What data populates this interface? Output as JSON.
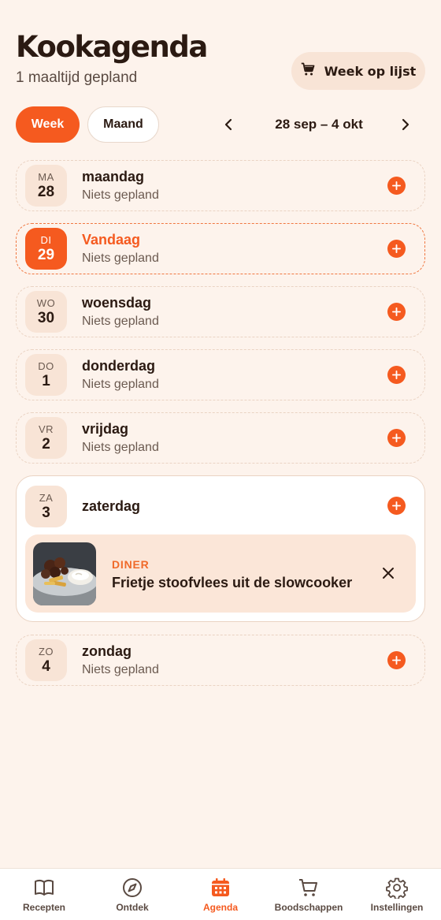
{
  "header": {
    "title": "Kookagenda",
    "subtitle": "1 maaltijd gepland",
    "week_list_label": "Week op lijst"
  },
  "controls": {
    "week_label": "Week",
    "month_label": "Maand",
    "range": "28 sep – 4 okt"
  },
  "days": [
    {
      "abbr": "MA",
      "num": "28",
      "name": "maandag",
      "status": "Niets gepland"
    },
    {
      "abbr": "DI",
      "num": "29",
      "name": "Vandaag",
      "status": "Niets gepland"
    },
    {
      "abbr": "WO",
      "num": "30",
      "name": "woensdag",
      "status": "Niets gepland"
    },
    {
      "abbr": "DO",
      "num": "1",
      "name": "donderdag",
      "status": "Niets gepland"
    },
    {
      "abbr": "VR",
      "num": "2",
      "name": "vrijdag",
      "status": "Niets gepland"
    },
    {
      "abbr": "ZA",
      "num": "3",
      "name": "zaterdag",
      "status": ""
    },
    {
      "abbr": "ZO",
      "num": "4",
      "name": "zondag",
      "status": "Niets gepland"
    }
  ],
  "meal": {
    "type": "DINER",
    "title": "Frietje stoofvlees uit de slowcooker"
  },
  "tabs": [
    {
      "label": "Recepten",
      "icon": "book-icon"
    },
    {
      "label": "Ontdek",
      "icon": "compass-icon"
    },
    {
      "label": "Agenda",
      "icon": "calendar-icon"
    },
    {
      "label": "Boodschappen",
      "icon": "cart-icon"
    },
    {
      "label": "Instellingen",
      "icon": "gear-icon"
    }
  ],
  "colors": {
    "accent": "#F55A1F",
    "background": "#FDF3EC",
    "badge": "#F8E4D6"
  }
}
